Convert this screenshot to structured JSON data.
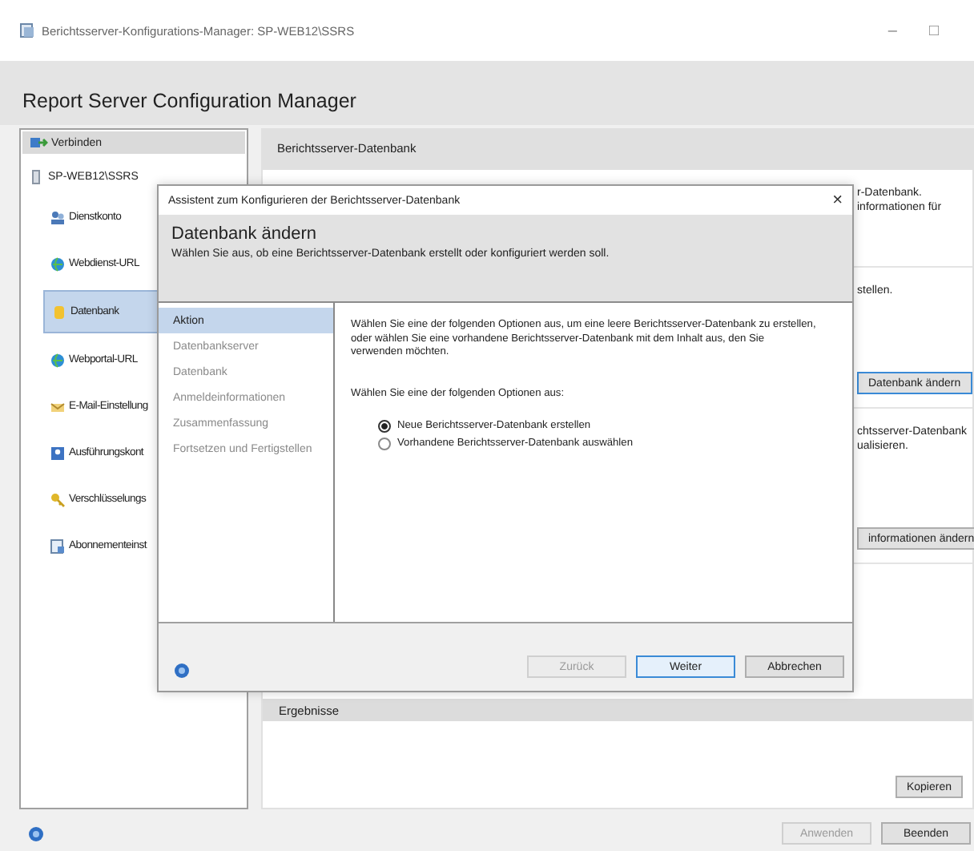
{
  "window": {
    "title": "Berichtsserver-Konfigurations-Manager: SP-WEB12\\SSRS",
    "controls": [
      "–",
      "□"
    ]
  },
  "app_title": "Report Server Configuration Manager",
  "sidebar": {
    "connect": "Verbinden",
    "server": "SP-WEB12\\SSRS",
    "items": [
      {
        "label": "Dienstkonto",
        "selected": false
      },
      {
        "label": "Webdienst-URL",
        "selected": false
      },
      {
        "label": "Datenbank",
        "selected": true
      },
      {
        "label": "Webportal-URL",
        "selected": false
      },
      {
        "label": "E-Mail-Einstellung",
        "selected": false
      },
      {
        "label": "Ausführungskont",
        "selected": false
      },
      {
        "label": "Verschlüsselungs",
        "selected": false
      },
      {
        "label": "Abonnementeinst",
        "selected": false
      }
    ]
  },
  "panel": {
    "title": "Berichtsserver-Datenbank",
    "sections": [
      {
        "lines": [
          "r-Datenbank.",
          "informationen für"
        ]
      },
      {
        "lines": [
          "stellen."
        ],
        "button": "Datenbank ändern"
      },
      {
        "lines": [
          "chtsserver-Datenbank",
          "ualisieren."
        ],
        "button": "informationen ändern"
      }
    ],
    "results_title": "Ergebnisse",
    "copy_button": "Kopieren"
  },
  "footer_buttons": [
    {
      "label": "Anwenden",
      "disabled": true
    },
    {
      "label": "Beenden",
      "disabled": false
    }
  ],
  "dialog": {
    "title": "Assistent zum Konfigurieren der Berichtsserver-Datenbank",
    "close": "×",
    "heading": "Datenbank ändern",
    "subtitle": "Wählen Sie aus, ob eine Berichtsserver-Datenbank erstellt oder konfiguriert werden soll.",
    "steps": [
      {
        "label": "Aktion",
        "selected": true
      },
      {
        "label": "Datenbankserver",
        "selected": false
      },
      {
        "label": "Datenbank",
        "selected": false
      },
      {
        "label": "Anmeldeinformationen",
        "selected": false
      },
      {
        "label": "Zusammenfassung",
        "selected": false
      },
      {
        "label": "Fortsetzen und Fertigstellen",
        "selected": false
      }
    ],
    "intro": "Wählen Sie eine der folgenden Optionen aus, um eine leere Berichtsserver-Datenbank zu erstellen, oder wählen Sie eine vorhandene Berichtsserver-Datenbank mit dem Inhalt aus, den Sie verwenden möchten.",
    "prompt": "Wählen Sie eine der folgenden Optionen aus:",
    "options": [
      {
        "label": "Neue Berichtsserver-Datenbank erstellen",
        "selected": true
      },
      {
        "label": "Vorhandene Berichtsserver-Datenbank auswählen",
        "selected": false
      }
    ],
    "buttons": [
      {
        "label": "Zurück",
        "disabled": true,
        "default": false
      },
      {
        "label": "Weiter",
        "disabled": false,
        "default": true
      },
      {
        "label": "Abbrechen",
        "disabled": false,
        "default": false
      }
    ]
  }
}
